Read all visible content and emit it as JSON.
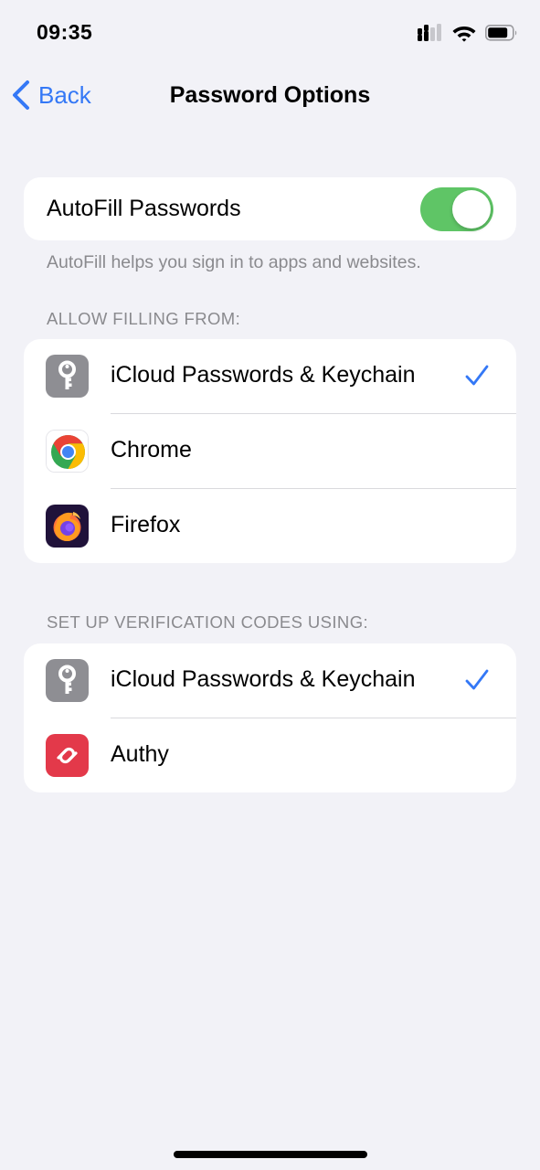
{
  "status_bar": {
    "time": "09:35",
    "icons": [
      "signal-icon",
      "wifi-icon",
      "battery-icon"
    ]
  },
  "nav": {
    "back_label": "Back",
    "title": "Password Options"
  },
  "autofill": {
    "label": "AutoFill Passwords",
    "enabled": true,
    "footer": "AutoFill helps you sign in to apps and websites."
  },
  "allow_filling": {
    "header": "ALLOW FILLING FROM:",
    "items": [
      {
        "label": "iCloud Passwords & Keychain",
        "icon": "key-icon",
        "checked": true
      },
      {
        "label": "Chrome",
        "icon": "chrome-icon",
        "checked": false
      },
      {
        "label": "Firefox",
        "icon": "firefox-icon",
        "checked": false
      }
    ]
  },
  "verification": {
    "header": "SET UP VERIFICATION CODES USING:",
    "items": [
      {
        "label": "iCloud Passwords & Keychain",
        "icon": "key-icon",
        "checked": true
      },
      {
        "label": "Authy",
        "icon": "authy-icon",
        "checked": false
      }
    ]
  },
  "colors": {
    "accent": "#3478f6",
    "toggle_on": "#5fc566",
    "background": "#f2f2f7",
    "secondary_text": "#8a8a8e"
  }
}
